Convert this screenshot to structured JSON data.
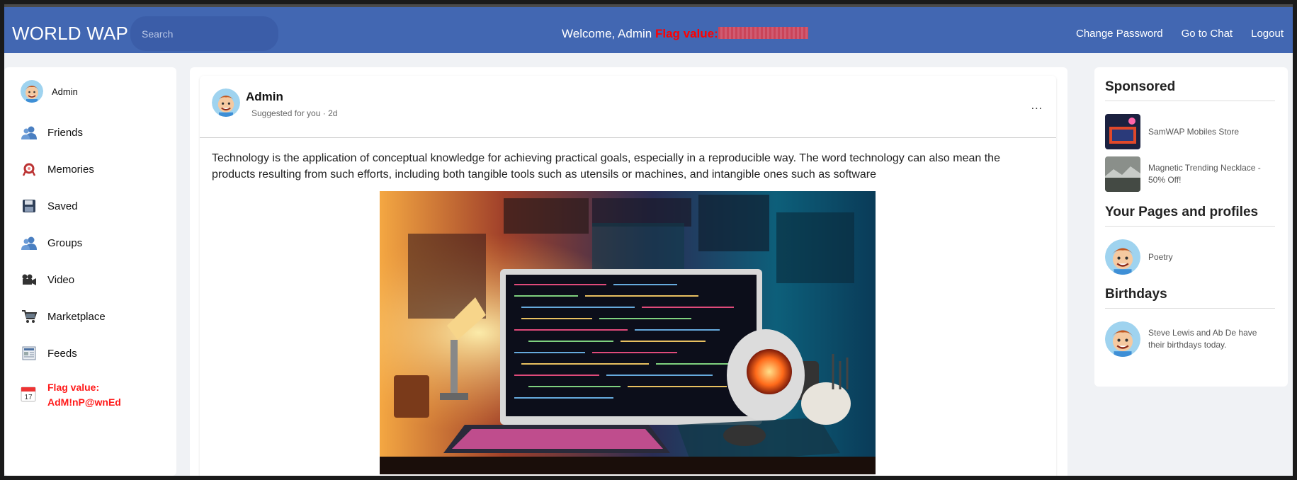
{
  "header": {
    "brand": "WORLD WAP",
    "search_placeholder": "Search",
    "welcome": "Welcome, Admin",
    "flag_label": "Flag value:",
    "nav": [
      "Change Password",
      "Go to Chat",
      "Logout"
    ]
  },
  "sidebar": {
    "profile_name": "Admin",
    "items": [
      {
        "label": "Friends",
        "icon": "friends-icon"
      },
      {
        "label": "Memories",
        "icon": "memories-icon"
      },
      {
        "label": "Saved",
        "icon": "save-icon"
      },
      {
        "label": "Groups",
        "icon": "groups-icon"
      },
      {
        "label": "Video",
        "icon": "video-camera-icon"
      },
      {
        "label": "Marketplace",
        "icon": "cart-icon"
      },
      {
        "label": "Feeds",
        "icon": "newspaper-icon"
      }
    ],
    "flag_text": "Flag value: AdM!nP@wnEd",
    "flag_icon": "calendar-icon",
    "calendar_day": "17"
  },
  "post": {
    "author": "Admin",
    "meta": "Suggested for you · 2d",
    "more": "...",
    "text": "Technology is the application of conceptual knowledge for achieving practical goals, especially in a reproducible way. The word technology can also mean the products resulting from such efforts, including both tangible tools such as utensils or machines, and intangible ones such as software"
  },
  "right": {
    "sponsored_title": "Sponsored",
    "sponsored": [
      {
        "label": "SamWAP Mobiles Store"
      },
      {
        "label": "Magnetic Trending Necklace - 50% Off!"
      }
    ],
    "pages_title": "Your Pages and profiles",
    "pages": [
      {
        "label": "Poetry"
      }
    ],
    "birthdays_title": "Birthdays",
    "birthdays": [
      {
        "label": "Steve Lewis and Ab De have their birthdays today."
      }
    ]
  },
  "colors": {
    "topbar": "#4267b2",
    "flag": "#ff0000",
    "background": "#f0f2f5"
  }
}
